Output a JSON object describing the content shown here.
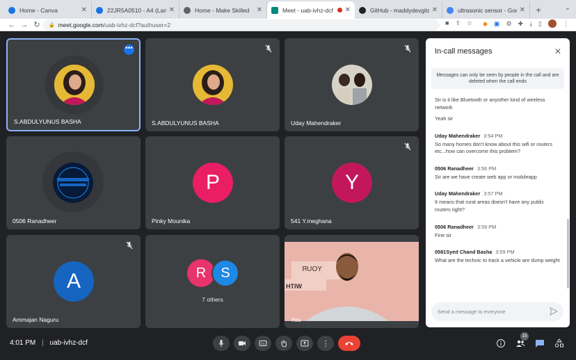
{
  "browser": {
    "tabs": [
      {
        "label": "Home - Canva",
        "favicon_color": "#1a73e8",
        "active": false
      },
      {
        "label": "22JR5A0510 - A4 (Landsc",
        "favicon_color": "#1a73e8",
        "active": false
      },
      {
        "label": "Home - Make Skilled",
        "favicon_color": "#5f6368",
        "active": false
      },
      {
        "label": "Meet - uab-ivhz-dcf",
        "favicon_color": "#00897b",
        "active": true
      },
      {
        "label": "GitHub - maddydevgits/fut",
        "favicon_color": "#202124",
        "active": false
      },
      {
        "label": "ultrasonic sensor - Google",
        "favicon_color": "#4285f4",
        "active": false
      }
    ],
    "url_host": "meet.google.com",
    "url_path": "/uab-ivhz-dcf?authuser=2"
  },
  "tiles": [
    {
      "name": "S.ABDULYUNUS BASHA",
      "type": "photo",
      "muted": false,
      "pinned": true
    },
    {
      "name": "S.ABDULYUNUS BASHA",
      "type": "photo",
      "muted": true
    },
    {
      "name": "Uday Mahendraker",
      "type": "photo",
      "muted": true
    },
    {
      "name": "0506 Ranadheer",
      "type": "photo",
      "muted": false
    },
    {
      "name": "Pinky Mounika",
      "type": "letter",
      "letter": "P",
      "color": "#e91e63",
      "muted": true
    },
    {
      "name": "541 Y.meghana",
      "type": "letter",
      "letter": "Y",
      "color": "#c2185b",
      "muted": true
    },
    {
      "name": "Ammajan Naguru",
      "type": "letter",
      "letter": "A",
      "color": "#1565c0",
      "muted": true
    },
    {
      "name": "7 others",
      "type": "group",
      "letters": [
        "R",
        "S"
      ],
      "colors": [
        "#e8336d",
        "#1e88e5"
      ]
    },
    {
      "name": "You",
      "type": "video"
    }
  ],
  "panel": {
    "title": "In-call messages",
    "notice": "Messages can only be seen by people in the call and are deleted when the call ends",
    "messages": [
      {
        "sender": "",
        "time": "",
        "lines": [
          "Sir is it like Bluetooth or anyother kind of wireless network",
          "Yeah sir"
        ]
      },
      {
        "sender": "Uday Mahendraker",
        "time": "3:54 PM",
        "lines": [
          "So many homes don't know about this wifi or routers etc...how can overcome this problem?"
        ]
      },
      {
        "sender": "0506 Ranadheer",
        "time": "3:56 PM",
        "lines": [
          "Sir are we have create web app or mobileapp"
        ]
      },
      {
        "sender": "Uday Mahendraker",
        "time": "3:57 PM",
        "lines": [
          "It means that rural areas doesn't have any public routers right?"
        ]
      },
      {
        "sender": "0506 Ranadheer",
        "time": "3:59 PM",
        "lines": [
          "Fine sir"
        ]
      },
      {
        "sender": "0581Syed Chand Basha",
        "time": "3:59 PM",
        "lines": [
          "What are the technic to track a vehicle are dump weight"
        ]
      }
    ],
    "input_placeholder": "Send a message to everyone"
  },
  "bottom": {
    "time": "4:01 PM",
    "meeting_code": "uab-ivhz-dcf",
    "participants_count": "15",
    "controls": [
      "mic-icon",
      "camera-icon",
      "captions-icon",
      "raise-hand-icon",
      "present-icon",
      "more-options-icon",
      "end-call-icon"
    ]
  },
  "colors": {
    "background": "#202124",
    "tile": "#3c4043",
    "accent": "#8ab4f8",
    "end_call": "#ea4335",
    "chat_active": "#8ab4f8"
  }
}
